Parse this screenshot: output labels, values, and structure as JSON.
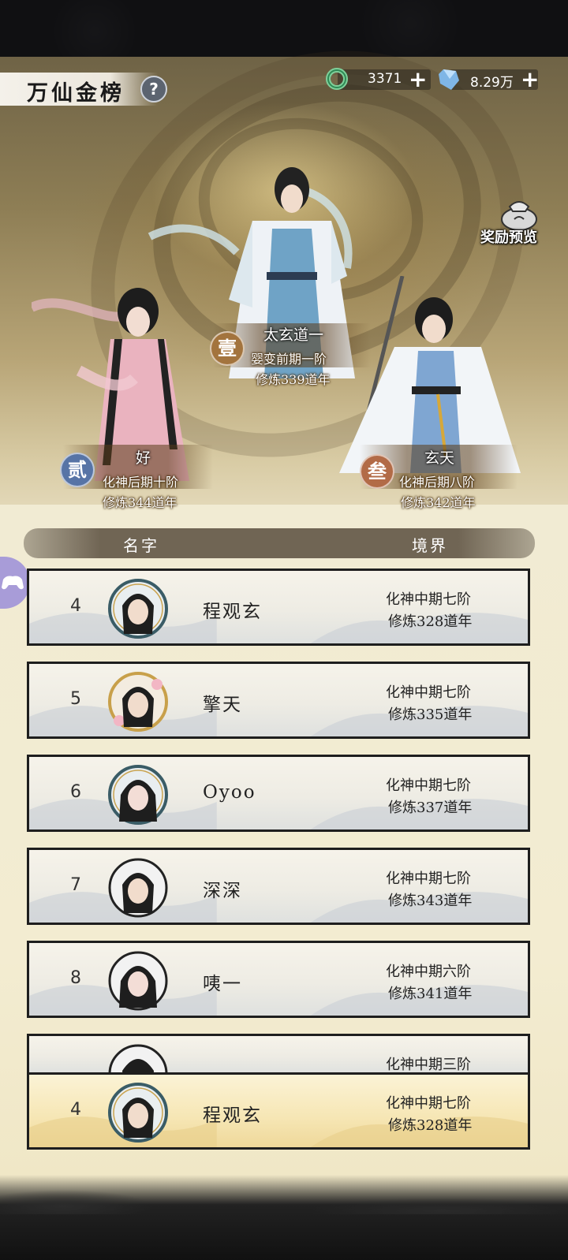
{
  "header": {
    "title": "万仙金榜",
    "help_icon": "question-icon"
  },
  "currencies": [
    {
      "icon": "jade-ring-icon",
      "value": "3371"
    },
    {
      "icon": "spirit-crystal-icon",
      "value": "8.29万"
    }
  ],
  "reward_preview": {
    "label": "奖励预览",
    "icon": "treasure-bag-icon"
  },
  "podium": [
    {
      "medal": "壹",
      "name": "太玄道一",
      "realm": "婴变前期一阶",
      "years": "修炼339道年"
    },
    {
      "medal": "贰",
      "name": "好",
      "realm": "化神后期十阶",
      "years": "修炼344道年"
    },
    {
      "medal": "叁",
      "name": "玄天",
      "realm": "化神后期八阶",
      "years": "修炼342道年"
    }
  ],
  "table": {
    "columns": [
      "名字",
      "境界"
    ],
    "rows": [
      {
        "rank": "4",
        "name": "程观玄",
        "realm": "化神中期七阶",
        "years": "修炼328道年"
      },
      {
        "rank": "5",
        "name": "擎天",
        "realm": "化神中期七阶",
        "years": "修炼335道年"
      },
      {
        "rank": "6",
        "name": "Oyoo",
        "realm": "化神中期七阶",
        "years": "修炼337道年"
      },
      {
        "rank": "7",
        "name": "深深",
        "realm": "化神中期七阶",
        "years": "修炼343道年"
      },
      {
        "rank": "8",
        "name": "咦一",
        "realm": "化神中期六阶",
        "years": "修炼341道年"
      },
      {
        "rank": "",
        "name": "",
        "realm": "化神中期三阶",
        "years": ""
      }
    ]
  },
  "self_row": {
    "rank": "4",
    "name": "程观玄",
    "realm": "化神中期七阶",
    "years": "修炼328道年"
  },
  "side_button": {
    "icon": "gamepad-icon"
  }
}
